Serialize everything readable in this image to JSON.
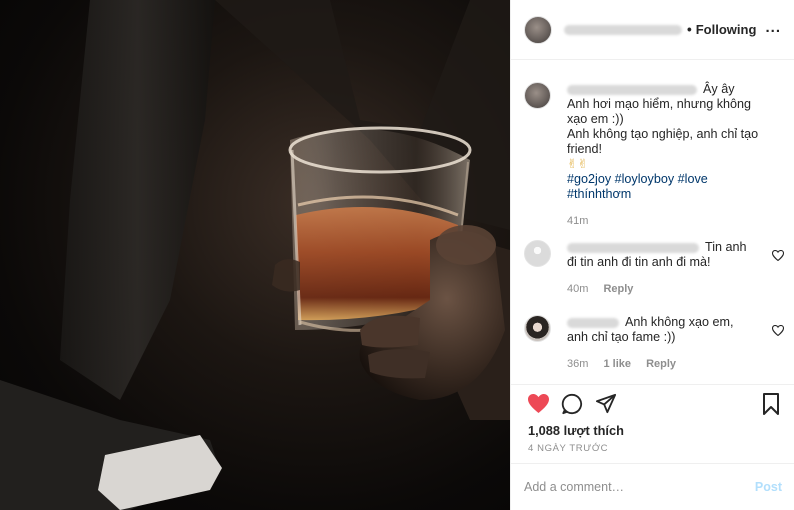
{
  "header": {
    "username_blurred": "username",
    "separator": "•",
    "follow_label": "Following",
    "more_label": "..."
  },
  "caption": {
    "lines": [
      "Ây ây",
      "Anh hơi mạo hiểm, nhưng không",
      "xạo em :))",
      "Anh không tạo nghiệp, anh chỉ tạo",
      "friend!",
      "✌✌"
    ],
    "hashtags_line1": [
      "#go2joy",
      "#loyloyboy",
      "#love"
    ],
    "hashtags_line2": [
      "#thínhthơm"
    ],
    "time": "41m"
  },
  "comments": [
    {
      "lines": [
        "Tin anh",
        "đi tin anh đi tin anh đi mà!"
      ],
      "time": "40m",
      "likes": "",
      "reply_label": "Reply"
    },
    {
      "lines": [
        "Anh không xạo em,",
        "anh chỉ tạo fame :))"
      ],
      "time": "36m",
      "likes": "1 like",
      "reply_label": "Reply"
    }
  ],
  "actions": {
    "likes_text": "1,088 lượt thích",
    "date_text": "4 NGÀY TRƯỚC",
    "heart_color": "#ed4956"
  },
  "add_comment": {
    "placeholder": "Add a comment…",
    "post_label": "Post",
    "post_color": "#b2dffc"
  }
}
